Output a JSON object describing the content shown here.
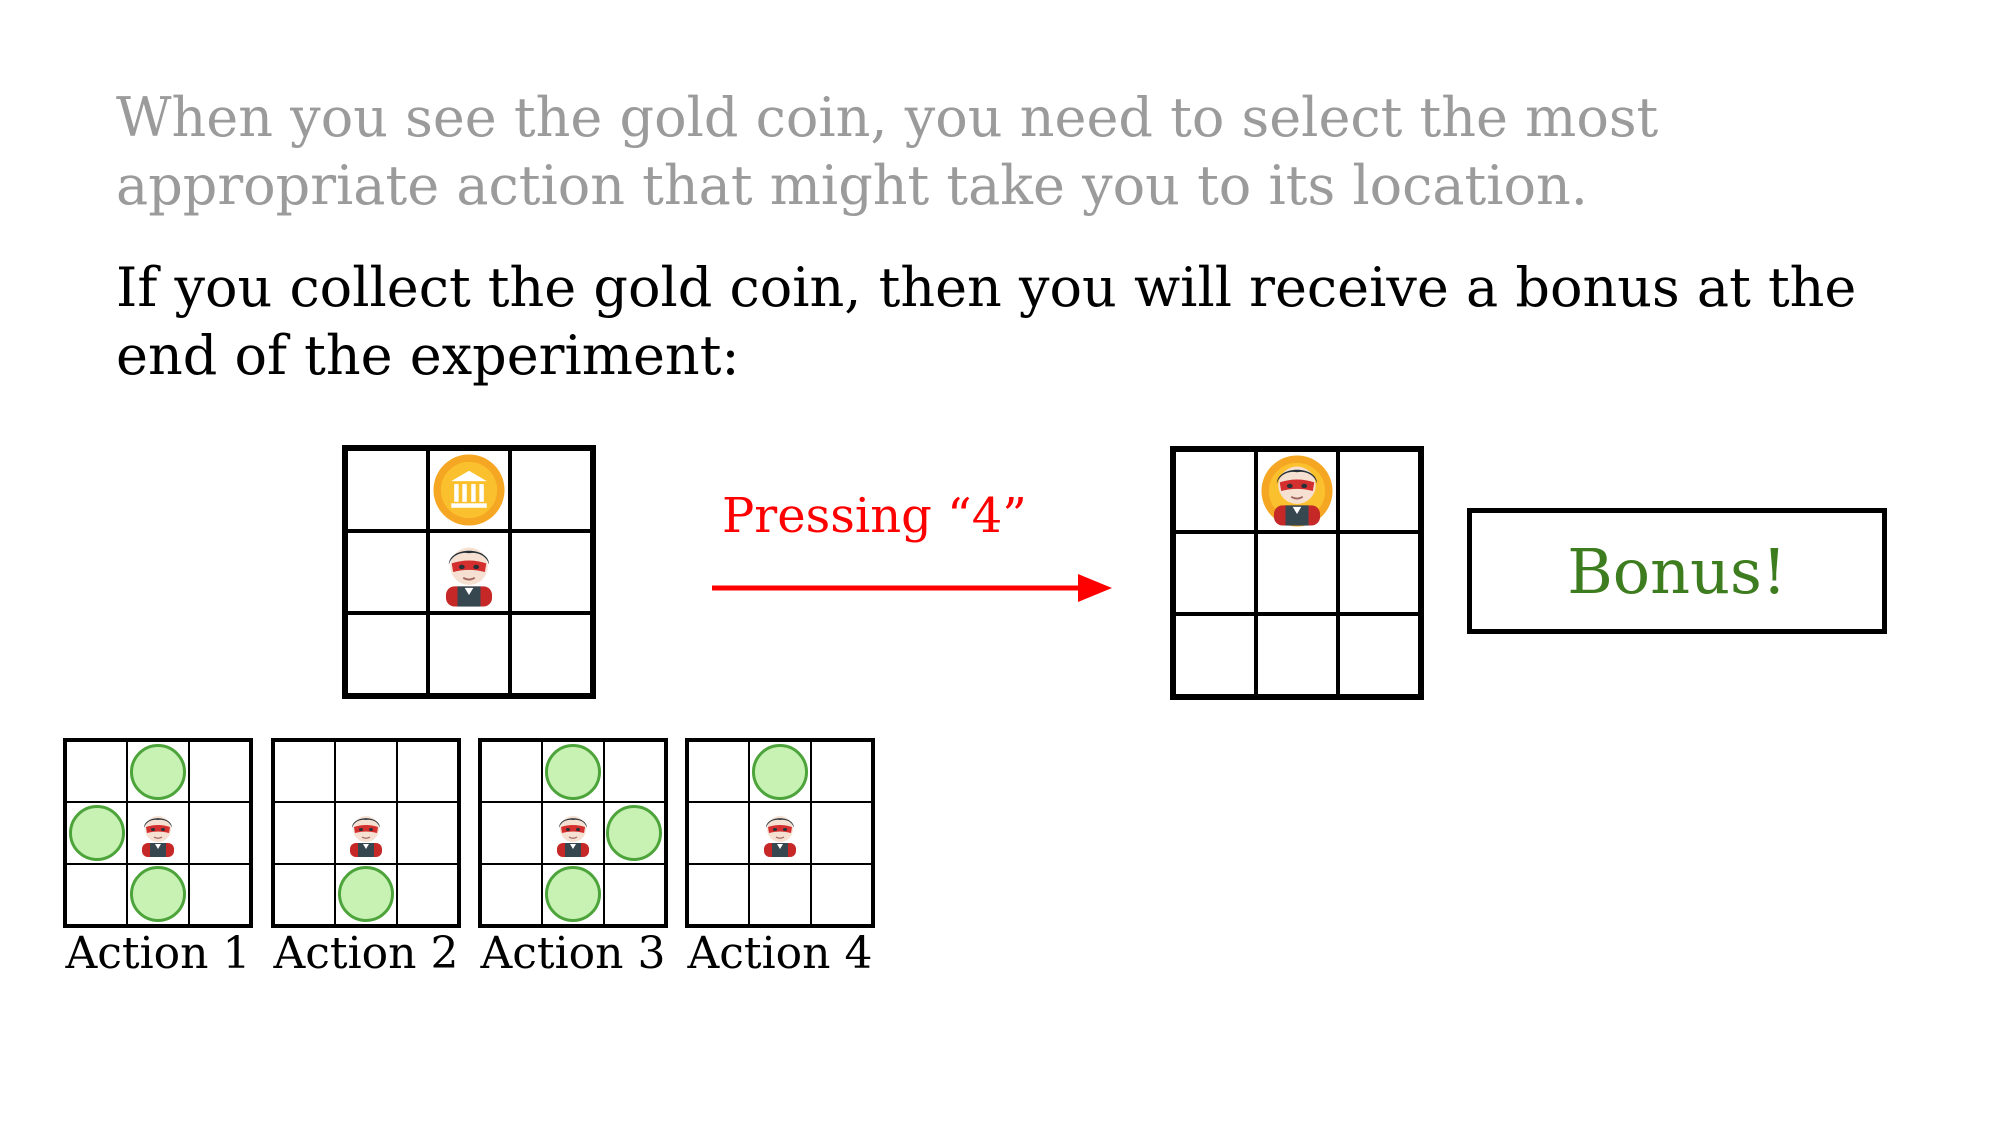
{
  "instructions": {
    "intro": "When you see the gold coin, you need to select the most appropriate action that might take you to its location.",
    "bonus_rule": "If you collect the gold coin, then you will receive a bonus at the end of the experiment:"
  },
  "transition": {
    "label": "Pressing “4”",
    "arrow_color": "#ff0000"
  },
  "bonus": {
    "label": "Bonus!",
    "text_color": "#3e7d1f"
  },
  "actions": [
    {
      "label": "Action 1"
    },
    {
      "label": "Action 2"
    },
    {
      "label": "Action 3"
    },
    {
      "label": "Action 4"
    }
  ],
  "icons": {
    "agent": "superhero-icon",
    "coin": "gold-coin-icon",
    "target": "green-circle"
  },
  "colors": {
    "intro_text": "#9b9b9b",
    "target_fill": "#c8f2b4",
    "target_stroke": "#4ca43a",
    "coin": "#f5b323"
  }
}
